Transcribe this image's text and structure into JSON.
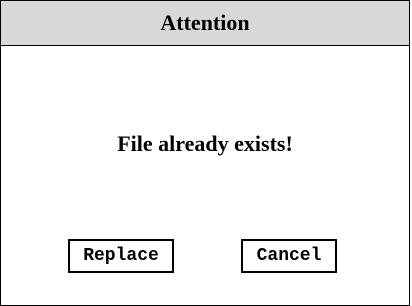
{
  "dialog": {
    "title": "Attention",
    "message": "File already exists!",
    "buttons": {
      "replace_label": "Replace",
      "cancel_label": "Cancel"
    }
  },
  "colors": {
    "titlebar_background": "#d8d8d8",
    "border": "#000000",
    "background": "#ffffff",
    "text": "#000000"
  }
}
